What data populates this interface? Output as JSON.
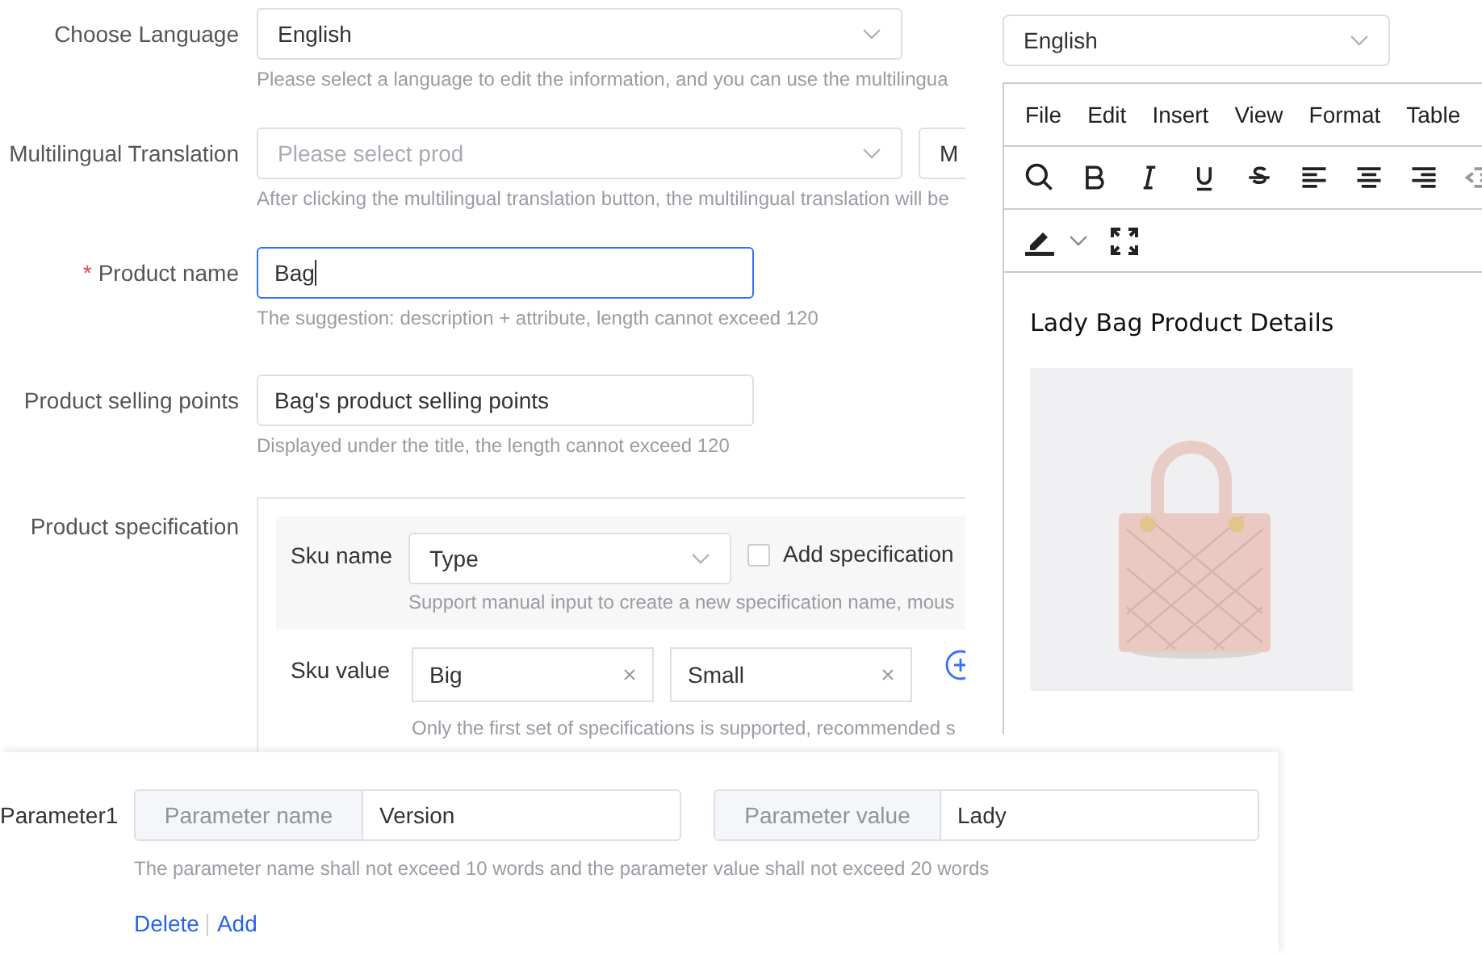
{
  "form": {
    "rows": [
      {
        "kind": "select",
        "label": "Choose Language",
        "value": "English",
        "hint": "Please select a language to edit the information, and you can use the multilingua"
      },
      {
        "kind": "translate",
        "label": "Multilingual Translation",
        "placeholder": "Please select prod",
        "button": "M",
        "hint": "After clicking the multilingual translation button, the multilingual translation will be"
      },
      {
        "kind": "input",
        "label": "Product name",
        "required_mark": "*",
        "focused": true,
        "value": "Bag",
        "hint": "The suggestion: description + attribute, length cannot exceed 120"
      },
      {
        "kind": "input",
        "label": "Product selling points",
        "focused": false,
        "value": "Bag's product selling points",
        "hint": "Displayed under the title, the length cannot exceed 120"
      }
    ],
    "specification": {
      "label": "Product specification",
      "sku_name": {
        "label": "Sku name",
        "value": "Type",
        "checkbox": {
          "label": "Add specification",
          "checked": false
        },
        "hint": "Support manual input to create a new specification name, mous"
      },
      "sku_value": {
        "label": "Sku value",
        "values": [
          "Big",
          "Small"
        ],
        "hint": "Only the first set of specifications is supported, recommended s"
      }
    }
  },
  "editor": {
    "language": "English",
    "menu": [
      "File",
      "Edit",
      "Insert",
      "View",
      "Format",
      "Table"
    ],
    "heading": "Lady Bag Product Details"
  },
  "parameters": {
    "rows": [
      {
        "label": "Parameter1",
        "name_label": "Parameter name",
        "name": "Version",
        "value_label": "Parameter value",
        "value": "Lady"
      }
    ],
    "hint": "The parameter name shall not exceed 10 words and the parameter value shall not exceed 20 words",
    "links": [
      "Delete",
      "Add"
    ]
  }
}
